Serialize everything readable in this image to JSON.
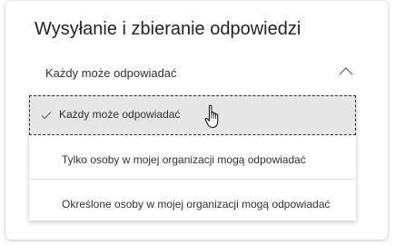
{
  "panel": {
    "title": "Wysyłanie i zbieranie odpowiedzi"
  },
  "dropdown": {
    "selected_value": "Każdy może odpowiadać",
    "expanded": true,
    "toggle_icon": "chevron-up-icon",
    "options": [
      {
        "label": "Każdy może odpowiadać",
        "selected": true,
        "icon": "check-icon"
      },
      {
        "label": "Tylko osoby w mojej organizacji mogą odpowiadać",
        "selected": false
      },
      {
        "label": "Określone osoby w mojej organizacji mogą odpowiadać",
        "selected": false
      }
    ]
  },
  "pointer": {
    "icon": "hand-cursor-icon"
  },
  "colors": {
    "text": "#323130",
    "title_text": "#252423",
    "selected_background": "#e6e6e6",
    "separator": "#e1dfdd",
    "focus_outline": "#323130"
  }
}
